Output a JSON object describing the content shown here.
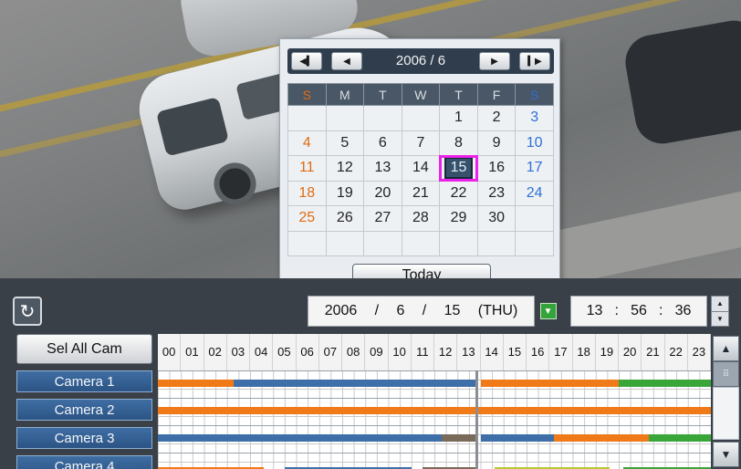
{
  "calendar": {
    "title": "2006 / 6",
    "nav": {
      "first": "◀▍",
      "prev": "◀",
      "next": "▶",
      "last": "▍▶"
    },
    "weekdays": [
      "S",
      "M",
      "T",
      "W",
      "T",
      "F",
      "S"
    ],
    "weeks": [
      [
        "",
        "",
        "",
        "",
        "1",
        "2",
        "3"
      ],
      [
        "4",
        "5",
        "6",
        "7",
        "8",
        "9",
        "10"
      ],
      [
        "11",
        "12",
        "13",
        "14",
        "15",
        "16",
        "17"
      ],
      [
        "18",
        "19",
        "20",
        "21",
        "22",
        "23",
        "24"
      ],
      [
        "25",
        "26",
        "27",
        "28",
        "29",
        "30",
        ""
      ],
      [
        "",
        "",
        "",
        "",
        "",
        "",
        ""
      ]
    ],
    "selected_day": "15",
    "today_label": "Today"
  },
  "controls": {
    "refresh_icon": "↻",
    "date": {
      "year": "2006",
      "sep1": "/",
      "month": "6",
      "sep2": "/",
      "day": "15",
      "weekday": "(THU)"
    },
    "date_drop_icon": "▼",
    "time": {
      "hour": "13",
      "sep1": ":",
      "minute": "56",
      "sep2": ":",
      "second": "36"
    },
    "spin_up": "▲",
    "spin_down": "▼"
  },
  "timeline": {
    "select_all_label": "Sel All Cam",
    "hours": [
      "00",
      "01",
      "02",
      "03",
      "04",
      "05",
      "06",
      "07",
      "08",
      "09",
      "10",
      "11",
      "12",
      "13",
      "14",
      "15",
      "16",
      "17",
      "18",
      "19",
      "20",
      "21",
      "22",
      "23"
    ],
    "cameras": [
      {
        "label": "Camera 1",
        "segments": [
          {
            "start": 0,
            "end": 3.3,
            "color": "#f07a18"
          },
          {
            "start": 3.3,
            "end": 13.8,
            "color": "#3f6fa8"
          },
          {
            "start": 14,
            "end": 20,
            "color": "#f07a18"
          },
          {
            "start": 20,
            "end": 24,
            "color": "#3aa63a"
          }
        ]
      },
      {
        "label": "Camera 2",
        "segments": [
          {
            "start": 0,
            "end": 24,
            "color": "#f07a18"
          }
        ]
      },
      {
        "label": "Camera 3",
        "segments": [
          {
            "start": 0,
            "end": 12.3,
            "color": "#3f6fa8"
          },
          {
            "start": 12.3,
            "end": 13.8,
            "color": "#7a6a5a"
          },
          {
            "start": 14,
            "end": 17.2,
            "color": "#3f6fa8"
          },
          {
            "start": 17.2,
            "end": 21.3,
            "color": "#f07a18"
          },
          {
            "start": 21.3,
            "end": 24,
            "color": "#3aa63a"
          }
        ]
      },
      {
        "label": "Camera 4",
        "segments": [
          {
            "start": 0,
            "end": 4.6,
            "color": "#f07a18"
          },
          {
            "start": 5.5,
            "end": 11,
            "color": "#3f6fa8"
          },
          {
            "start": 11.5,
            "end": 13.8,
            "color": "#7a6a5a"
          },
          {
            "start": 14.6,
            "end": 19.6,
            "color": "#b8c832"
          },
          {
            "start": 20.2,
            "end": 24,
            "color": "#3aa63a"
          }
        ]
      }
    ],
    "scroll_up": "▲",
    "scroll_down": "▼",
    "scroll_thumb": "⠿"
  }
}
